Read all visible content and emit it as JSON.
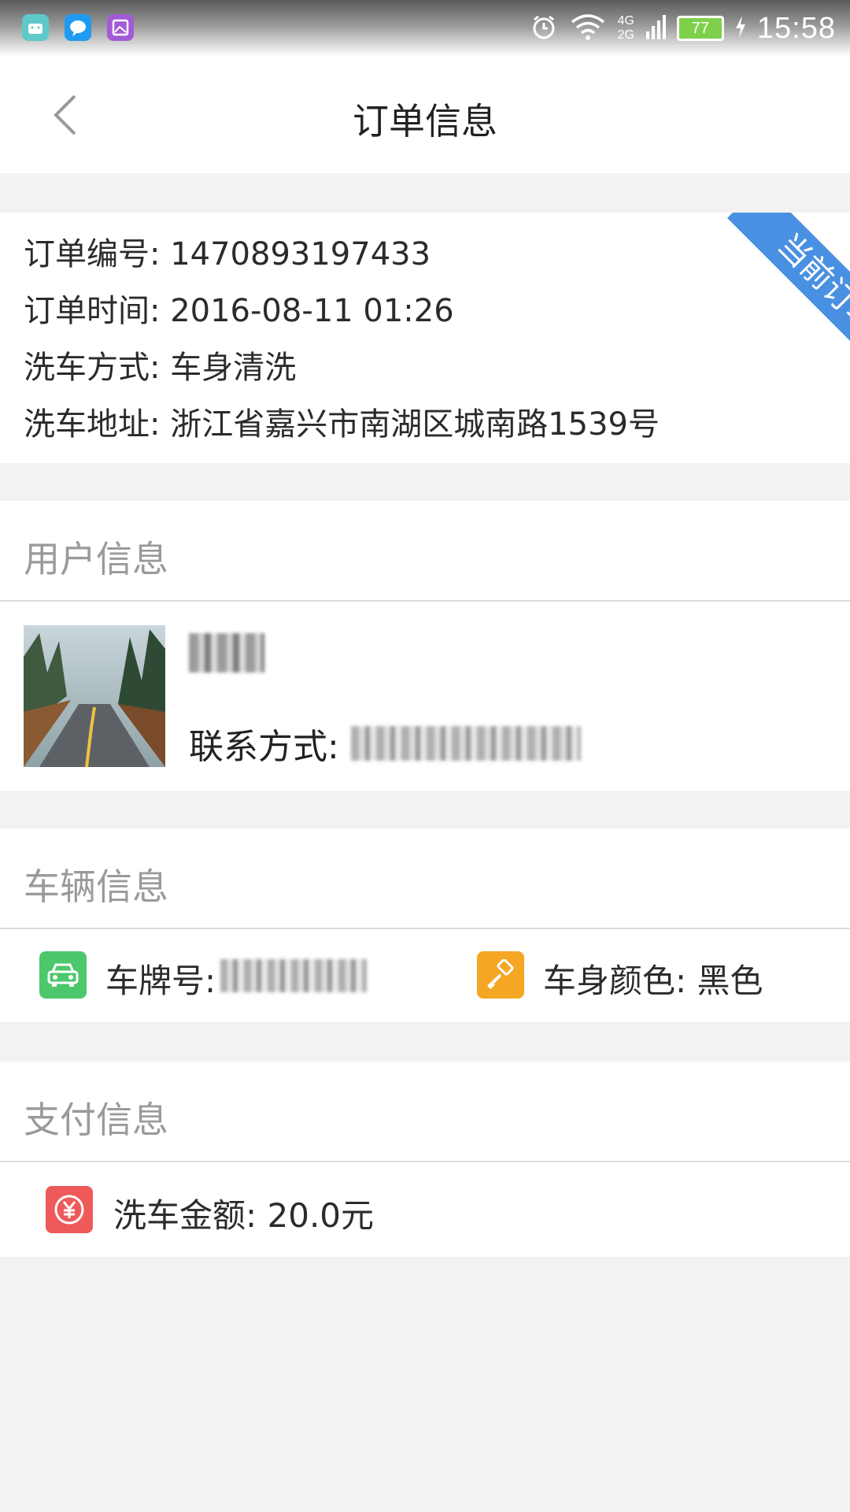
{
  "status_bar": {
    "time": "15:58",
    "battery_level": "77",
    "network_top": "4G",
    "network_bottom": "2G",
    "icons": [
      "android-app-icon",
      "chat-app-icon",
      "gallery-app-icon",
      "alarm-icon",
      "wifi-icon",
      "signal-icon",
      "battery-icon",
      "charging-icon"
    ]
  },
  "nav": {
    "title": "订单信息",
    "back_icon": "chevron-left-icon"
  },
  "order": {
    "ribbon": "当前订单",
    "number_label": "订单编号:",
    "number_value": "1470893197433",
    "time_label": "订单时间:",
    "time_value": "2016-08-11 01:26",
    "method_label": "洗车方式:",
    "method_value": "车身清洗",
    "address_label": "洗车地址:",
    "address_value": "浙江省嘉兴市南湖区城南路1539号"
  },
  "user": {
    "section_title": "用户信息",
    "contact_label": "联系方式:"
  },
  "vehicle": {
    "section_title": "车辆信息",
    "plate_label": "车牌号:",
    "color_label": "车身颜色:",
    "color_value": "黑色"
  },
  "payment": {
    "section_title": "支付信息",
    "amount_label": "洗车金额:",
    "amount_value": "20.0元"
  },
  "colors": {
    "ribbon": "#4a90e2",
    "car_icon_bg": "#4cc76b",
    "paint_icon_bg": "#f5a623",
    "money_icon_bg": "#ee5a5a",
    "section_title": "#9a9a9a",
    "page_bg": "#f2f2f2"
  }
}
